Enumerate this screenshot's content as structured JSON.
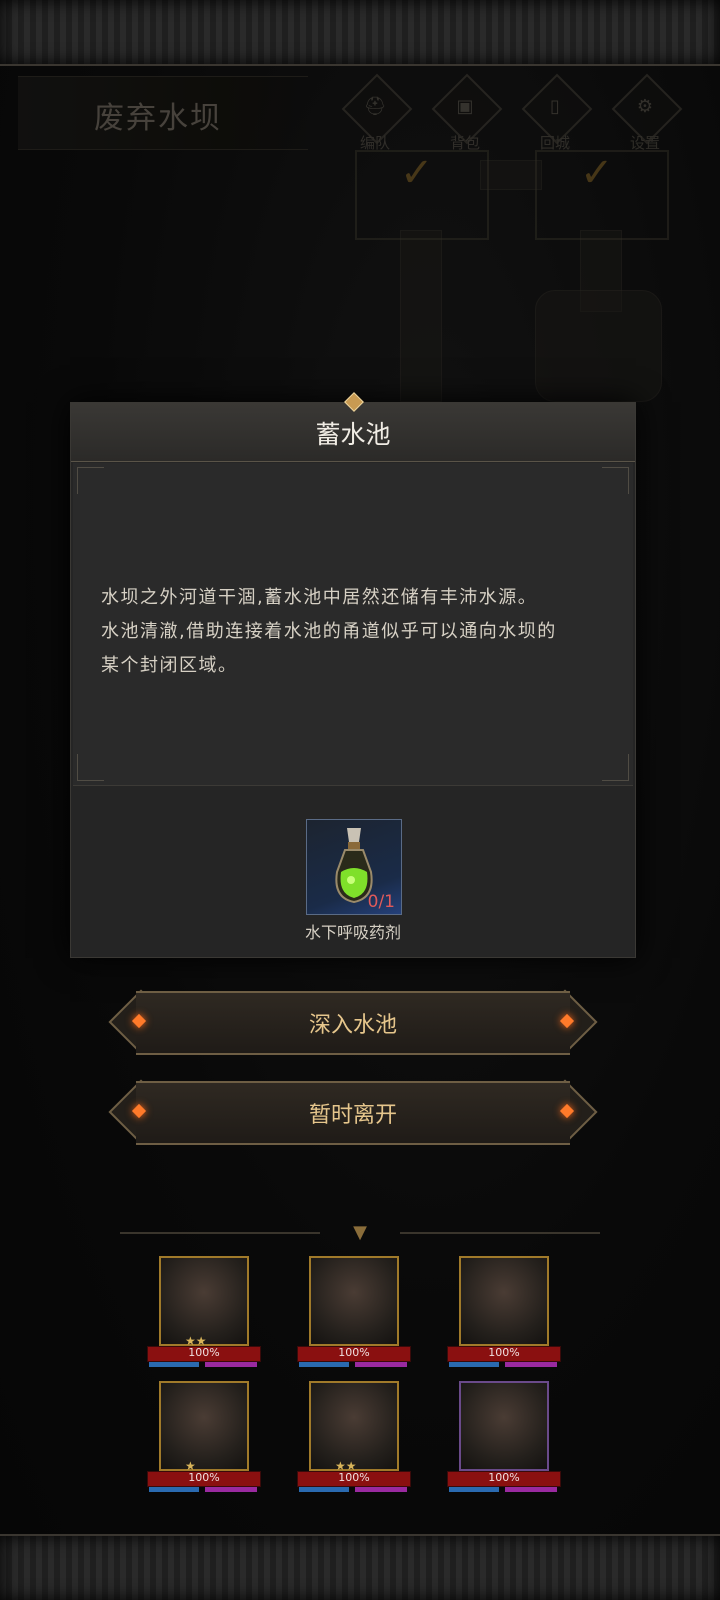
{
  "location": {
    "title": "废弃水坝"
  },
  "top_menu": [
    {
      "label": "编队",
      "icon": "helmet-icon"
    },
    {
      "label": "背包",
      "icon": "backpack-icon"
    },
    {
      "label": "回城",
      "icon": "door-icon"
    },
    {
      "label": "设置",
      "icon": "gear-icon"
    }
  ],
  "dialog": {
    "title": "蓄水池",
    "description_lines": [
      "水坝之外河道干涸,蓄水池中居然还储有丰沛水源。",
      "水池清澈,借助连接着水池的甬道似乎可以通向水坝的",
      "某个封闭区域。"
    ],
    "required_item": {
      "name": "水下呼吸药剂",
      "count": "0/1",
      "icon": "potion-icon"
    }
  },
  "actions": {
    "enter": "深入水池",
    "leave": "暂时离开"
  },
  "party": [
    {
      "hp": "100%",
      "stars": "★★"
    },
    {
      "hp": "100%",
      "stars": ""
    },
    {
      "hp": "100%",
      "stars": ""
    },
    {
      "hp": "100%",
      "stars": "★"
    },
    {
      "hp": "100%",
      "stars": "★★"
    },
    {
      "hp": "100%",
      "stars": ""
    }
  ],
  "colors": {
    "accent_gold": "#e6c68c",
    "ember": "#ff7a2a",
    "hp_red": "#8a1010"
  }
}
